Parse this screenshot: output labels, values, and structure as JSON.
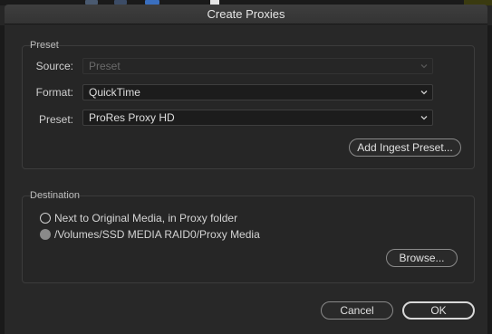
{
  "window": {
    "title": "Create Proxies"
  },
  "preset_group": {
    "label": "Preset",
    "source": {
      "label": "Source:",
      "value": "Preset"
    },
    "format": {
      "label": "Format:",
      "value": "QuickTime"
    },
    "preset": {
      "label": "Preset:",
      "value": "ProRes Proxy HD"
    },
    "add_ingest_button": "Add Ingest Preset..."
  },
  "destination_group": {
    "label": "Destination",
    "options": [
      {
        "label": "Next to Original Media, in Proxy folder",
        "selected": false
      },
      {
        "label": "/Volumes/SSD MEDIA RAID0/Proxy Media",
        "selected": true
      }
    ],
    "browse_button": "Browse..."
  },
  "footer": {
    "cancel": "Cancel",
    "ok": "OK"
  },
  "icons": {
    "dropdown": "chevron-down-icon"
  }
}
